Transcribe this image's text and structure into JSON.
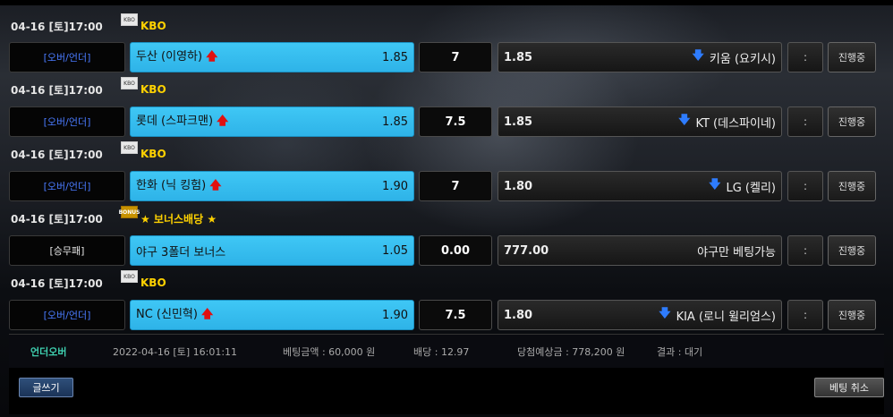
{
  "games": [
    {
      "date": "04-16 [토]17:00",
      "league_icon": "KBO",
      "league": "KBO",
      "bet_type": "[오버/언더]",
      "home_team": "두산 (이영하)",
      "home_odds": "1.85",
      "home_indicator": "arrow-up-icon",
      "line": "7",
      "away_odds": "1.85",
      "away_team": "키움 (요키시)",
      "away_indicator": "arrow-down-icon",
      "score": ":",
      "status": "진행중"
    },
    {
      "date": "04-16 [토]17:00",
      "league_icon": "KBO",
      "league": "KBO",
      "bet_type": "[오버/언더]",
      "home_team": "롯데 (스파크맨)",
      "home_odds": "1.85",
      "home_indicator": "arrow-up-icon",
      "line": "7.5",
      "away_odds": "1.85",
      "away_team": "KT (데스파이네)",
      "away_indicator": "arrow-down-icon",
      "score": ":",
      "status": "진행중"
    },
    {
      "date": "04-16 [토]17:00",
      "league_icon": "KBO",
      "league": "KBO",
      "bet_type": "[오버/언더]",
      "home_team": "한화 (닉 킹험)",
      "home_odds": "1.90",
      "home_indicator": "arrow-up-icon",
      "line": "7",
      "away_odds": "1.80",
      "away_team": "LG (켈리)",
      "away_indicator": "arrow-down-icon",
      "score": ":",
      "status": "진행중"
    },
    {
      "date": "04-16 [토]17:00",
      "league_icon": "BONUS",
      "league": "★ 보너스배당 ★",
      "bet_type": "[승무패]",
      "home_team": "야구 3폴더 보너스",
      "home_odds": "1.05",
      "line": "0.00",
      "away_odds": "777.00",
      "away_team": "야구만 베팅가능",
      "score": ":",
      "status": "진행중"
    },
    {
      "date": "04-16 [토]17:00",
      "league_icon": "KBO",
      "league": "KBO",
      "bet_type": "[오버/언더]",
      "home_team": "NC (신민혁)",
      "home_odds": "1.90",
      "home_indicator": "arrow-up-icon",
      "line": "7.5",
      "away_odds": "1.80",
      "away_team": "KIA (로니 윌리엄스)",
      "away_indicator": "arrow-down-icon",
      "score": ":",
      "status": "진행중"
    }
  ],
  "summary": {
    "type": "언더오버",
    "datetime": "2022-04-16 [토] 16:01:11",
    "bet_amount": "베팅금액 : 60,000 원",
    "odds": "배당 : 12.97",
    "expected_win": "당첨예상금 : 778,200 원",
    "result": "결과 : 대기"
  },
  "buttons": {
    "write": "글쓰기",
    "cancel_bet": "베팅 취소"
  },
  "colors": {
    "selected_bet": "#3fc7f5",
    "league_text": "#ffd200",
    "arrow_up": "#e01010",
    "arrow_down": "#2e7cff",
    "summary_type": "#3fd0b0",
    "bet_type_link": "#4a7bff"
  }
}
